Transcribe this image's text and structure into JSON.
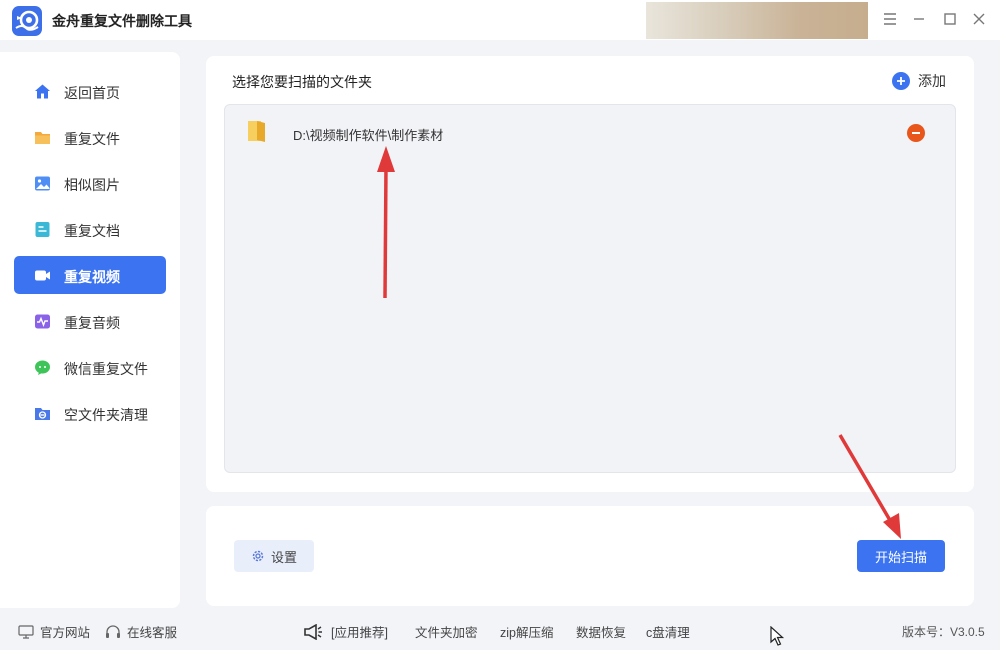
{
  "app": {
    "title": "金舟重复文件删除工具"
  },
  "sidebar": {
    "items": [
      {
        "label": "返回首页",
        "icon": "home-icon"
      },
      {
        "label": "重复文件",
        "icon": "folder-icon"
      },
      {
        "label": "相似图片",
        "icon": "image-icon"
      },
      {
        "label": "重复文档",
        "icon": "document-icon"
      },
      {
        "label": "重复视频",
        "icon": "video-icon",
        "active": true
      },
      {
        "label": "重复音频",
        "icon": "audio-icon"
      },
      {
        "label": "微信重复文件",
        "icon": "wechat-icon"
      },
      {
        "label": "空文件夹清理",
        "icon": "empty-folder-icon"
      }
    ]
  },
  "main": {
    "panel_title": "选择您要扫描的文件夹",
    "add_label": "添加",
    "folders": [
      {
        "path": "D:\\视频制作软件\\制作素材"
      }
    ],
    "settings_label": "设置",
    "scan_label": "开始扫描"
  },
  "footer": {
    "website": "官方网站",
    "support": "在线客服",
    "recommend": "[应用推荐]",
    "links": [
      "文件夹加密",
      "zip解压缩",
      "数据恢复",
      "c盘清理"
    ],
    "version": "版本号：V3.0.5"
  },
  "colors": {
    "accent": "#3b73f0",
    "remove": "#e8561b",
    "annotation_arrow": "#e0393a",
    "background": "#f2f4f8"
  }
}
